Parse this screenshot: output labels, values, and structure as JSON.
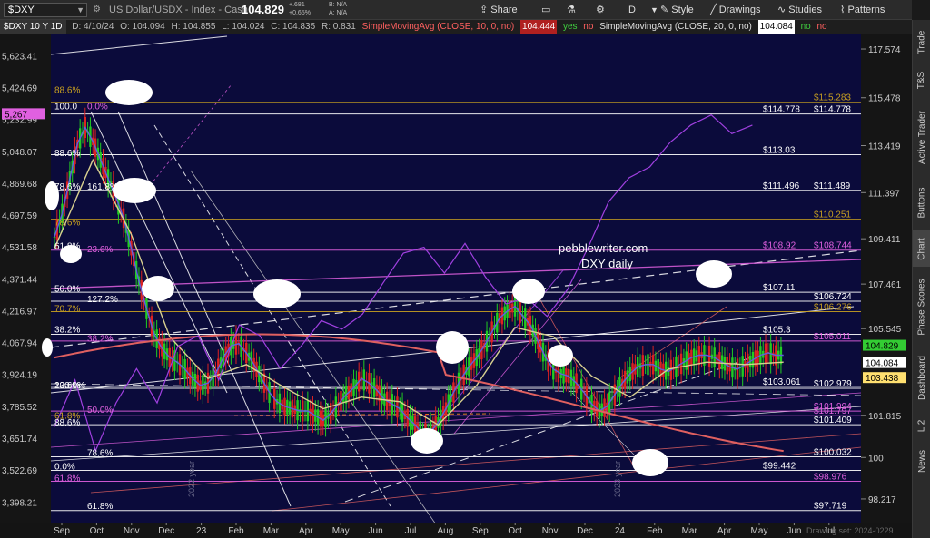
{
  "toolbar": {
    "symbol": "$DXY",
    "description": "US Dollar/USDX - Index - Cash",
    "last": "104.829",
    "change": "+.681",
    "change_pct": "+0.65%",
    "bid": "B: N/A",
    "ask": "A: N/A",
    "share_label": "Share",
    "aggregation": "D",
    "style_label": "Style",
    "drawings_label": "Drawings",
    "studies_label": "Studies",
    "patterns_label": "Patterns"
  },
  "status": {
    "period": "$DXY 10 Y 1D",
    "date": "D: 4/10/24",
    "open": "O: 104.094",
    "high": "H: 104.855",
    "low": "L: 104.024",
    "close": "C: 104.835",
    "range": "R: 0.831",
    "sma10": "SimpleMovingAvg (CLOSE, 10, 0, no)",
    "sma10_val": "104.444",
    "sma20": "SimpleMovingAvg (CLOSE, 20, 0, no)",
    "sma20_val": "104.084",
    "yes": "yes",
    "no": "no"
  },
  "side_tabs": [
    "Trade",
    "T&S",
    "Active Trader",
    "Buttons",
    "Chart",
    "Phase Scores",
    "Dashboard",
    "L 2",
    "News"
  ],
  "annotation": {
    "line1": "pebblewriter.com",
    "line2": "DXY daily"
  },
  "year_marks": [
    "2022 year",
    "2023 year"
  ],
  "drawing_status": "Drawing set: 2024-0229",
  "colors": {
    "background": "#0b0b3b",
    "price": "#a020d0",
    "spx": "#a040e0",
    "sma200": "#e06060",
    "sma_blue": "#6060e0",
    "sma_yellow": "#d8d090",
    "fib_gold": "#c8a020",
    "fib_magenta": "#e060e0",
    "white_line": "#ffffff"
  },
  "chart_data": {
    "type": "line",
    "ylim": [
      97.2,
      118.2
    ],
    "left_ylim": [
      3320,
      5760
    ],
    "x_ticks": [
      "Sep",
      "Oct",
      "Nov",
      "Dec",
      "23",
      "Feb",
      "Mar",
      "Apr",
      "May",
      "Jun",
      "Jul",
      "Aug",
      "Sep",
      "Oct",
      "Nov",
      "Dec",
      "24",
      "Feb",
      "Mar",
      "Apr",
      "May",
      "Jun",
      "Jul"
    ],
    "right_ticks": [
      117.574,
      115.478,
      113.419,
      111.397,
      109.411,
      107.461,
      105.545,
      101.815,
      100,
      98.217
    ],
    "left_ticks": [
      "5,623.41",
      "5,424.69",
      "5,232.99",
      "5,048.07",
      "4,869.68",
      "4,697.59",
      "4,531.58",
      "4,371.44",
      "4,216.97",
      "4,067.94",
      "3,924.19",
      "3,785.52",
      "3,651.74",
      "3,522.69",
      "3,398.21"
    ],
    "left_highlight": {
      "label": "5,267",
      "value": 5267
    },
    "right_labels": [
      {
        "label": "104.829",
        "value": 104.829,
        "color": "#33cc33"
      },
      {
        "label": "104.084",
        "value": 104.084,
        "color": "#ffffff"
      },
      {
        "label": "103.438",
        "value": 103.438,
        "color": "#ffe070"
      }
    ],
    "levels": [
      {
        "value": 115.283,
        "labels": [
          {
            "text": "115.283",
            "pos": "far"
          }
        ],
        "color": "#c8a020"
      },
      {
        "value": 114.778,
        "labels": [
          {
            "text": "114.778",
            "pos": "mid"
          },
          {
            "text": "114.778",
            "pos": "far"
          }
        ],
        "color": "#ffffff"
      },
      {
        "value": 113.03,
        "labels": [
          {
            "text": "113.03",
            "pos": "mid"
          }
        ],
        "color": "#ffffff"
      },
      {
        "value": 111.496,
        "labels": [
          {
            "text": "111.496",
            "pos": "mid"
          },
          {
            "text": "111.489",
            "pos": "far"
          }
        ],
        "color": "#ffffff"
      },
      {
        "value": 110.251,
        "labels": [
          {
            "text": "110.251",
            "pos": "far"
          }
        ],
        "color": "#c8a020"
      },
      {
        "value": 108.92,
        "labels": [
          {
            "text": "108.92",
            "pos": "mid"
          },
          {
            "text": "108.744",
            "pos": "far"
          }
        ],
        "color": "#e060e0"
      },
      {
        "value": 107.11,
        "labels": [
          {
            "text": "107.11",
            "pos": "mid"
          }
        ],
        "color": "#ffffff"
      },
      {
        "value": 106.724,
        "labels": [
          {
            "text": "106.724",
            "pos": "far"
          }
        ],
        "color": "#ffffff"
      },
      {
        "value": 106.276,
        "labels": [
          {
            "text": "106.276",
            "pos": "far"
          }
        ],
        "color": "#c8a020"
      },
      {
        "value": 105.3,
        "labels": [
          {
            "text": "105.3",
            "pos": "mid"
          }
        ],
        "color": "#ffffff"
      },
      {
        "value": 105.011,
        "labels": [
          {
            "text": "105.011",
            "pos": "far"
          }
        ],
        "color": "#e060e0"
      },
      {
        "value": 103.061,
        "labels": [
          {
            "text": "103.061",
            "pos": "mid"
          }
        ],
        "color": "#ffffff"
      },
      {
        "value": 102.979,
        "labels": [
          {
            "text": "102.979",
            "pos": "far"
          }
        ],
        "color": "#ffffff"
      },
      {
        "value": 101.994,
        "labels": [
          {
            "text": "101.994",
            "pos": "far"
          }
        ],
        "color": "#e060e0"
      },
      {
        "value": 101.797,
        "labels": [
          {
            "text": "101.797",
            "pos": "far"
          }
        ],
        "color": "#e060e0"
      },
      {
        "value": 101.409,
        "labels": [
          {
            "text": "101.409",
            "pos": "far"
          }
        ],
        "color": "#ffffff"
      },
      {
        "value": 100.032,
        "labels": [
          {
            "text": "100.032",
            "pos": "far"
          }
        ],
        "color": "#ffffff"
      },
      {
        "value": 99.442,
        "labels": [
          {
            "text": "99.442",
            "pos": "mid"
          }
        ],
        "color": "#ffffff"
      },
      {
        "value": 98.976,
        "labels": [
          {
            "text": "98.976",
            "pos": "far"
          }
        ],
        "color": "#e060e0"
      },
      {
        "value": 97.719,
        "labels": [
          {
            "text": "97.719",
            "pos": "far"
          }
        ],
        "color": "#ffffff"
      }
    ],
    "fib_labels": [
      {
        "text": "88.6%",
        "value": 115.6,
        "color": "#c8a020"
      },
      {
        "text": "0.0%",
        "value": 114.9,
        "color": "#e060e0"
      },
      {
        "text": "100.0",
        "value": 114.9,
        "color": "#ffffff"
      },
      {
        "text": "88.6%",
        "value": 112.9,
        "color": "#ffffff"
      },
      {
        "text": "161.8%",
        "value": 111.45,
        "color": "#ffffff"
      },
      {
        "text": "78.6%",
        "value": 111.45,
        "color": "#ffffff"
      },
      {
        "text": "78.6%",
        "value": 109.9,
        "color": "#c8a020"
      },
      {
        "text": "23.6%",
        "value": 108.75,
        "color": "#e060e0"
      },
      {
        "text": "61.8%",
        "value": 108.9,
        "color": "#ffffff"
      },
      {
        "text": "50.0%",
        "value": 107.05,
        "color": "#ffffff"
      },
      {
        "text": "127.2%",
        "value": 106.6,
        "color": "#ffffff"
      },
      {
        "text": "70.7%",
        "value": 106.2,
        "color": "#c8a020"
      },
      {
        "text": "38.2%",
        "value": 105.3,
        "color": "#ffffff"
      },
      {
        "text": "38.2%",
        "value": 104.9,
        "color": "#e060e0"
      },
      {
        "text": "100.0%",
        "value": 102.9,
        "color": "#ffffff"
      },
      {
        "text": "23.6%",
        "value": 102.9,
        "color": "#ffffff"
      },
      {
        "text": "50.0%",
        "value": 101.85,
        "color": "#e060e0"
      },
      {
        "text": "61.8%",
        "value": 101.6,
        "color": "#c8a020"
      },
      {
        "text": "88.6%",
        "value": 101.3,
        "color": "#ffffff"
      },
      {
        "text": "78.6%",
        "value": 100.0,
        "color": "#ffffff"
      },
      {
        "text": "0.0%",
        "value": 99.4,
        "color": "#ffffff"
      },
      {
        "text": "61.8%",
        "value": 98.9,
        "color": "#e060e0"
      },
      {
        "text": "61.8%",
        "value": 97.7,
        "color": "#ffffff"
      }
    ],
    "series": [
      {
        "name": "SimpleMovingAvg (CLOSE, 10, 0, no)",
        "x": [
          0,
          1,
          2,
          3,
          4,
          5,
          6,
          7,
          8,
          9,
          10,
          11,
          12,
          13,
          14,
          15,
          16,
          17,
          18,
          19,
          20,
          21,
          22,
          23,
          24,
          25,
          26,
          27,
          28,
          29,
          30,
          31,
          32,
          33,
          34,
          35,
          36,
          37,
          38,
          39,
          40,
          41,
          42,
          43,
          44,
          45,
          46,
          47,
          48,
          49,
          50,
          51,
          52,
          53,
          54,
          55,
          56,
          57,
          58,
          59,
          60,
          61,
          62,
          63,
          64,
          65,
          66,
          67,
          68,
          69,
          70,
          71,
          72,
          73,
          74,
          75,
          76,
          77,
          78,
          79,
          80,
          81,
          82,
          83,
          84,
          85,
          86,
          87,
          88,
          89,
          90,
          91,
          92,
          93,
          94,
          95
        ],
        "y": [
          109.5,
          110.5,
          112,
          113.5,
          114.2,
          113.6,
          112.8,
          112,
          111.2,
          110.3,
          109,
          107.6,
          106.4,
          105.3,
          104.7,
          104.3,
          104.1,
          103.8,
          103.4,
          103.1,
          103.2,
          103.6,
          104.3,
          104.8,
          104.9,
          104.5,
          104.0,
          103.4,
          102.8,
          102.4,
          102.2,
          102.1,
          102.0,
          102.0,
          101.8,
          101.6,
          101.9,
          102.3,
          102.7,
          103.0,
          103.4,
          103.2,
          102.9,
          102.5,
          102.3,
          102.1,
          101.7,
          101.4,
          101.0,
          101.1,
          101.5,
          102.1,
          102.8,
          103.4,
          103.9,
          104.3,
          104.8,
          105.4,
          106.0,
          106.3,
          106.5,
          106.1,
          105.7,
          105.0,
          104.3,
          103.8,
          103.6,
          103.5,
          103.2,
          102.8,
          102.3,
          102.0,
          102.2,
          102.7,
          103.2,
          103.6,
          103.9,
          104.0,
          104.0,
          103.8,
          103.7,
          103.9,
          104.1,
          104.3,
          104.4,
          104.4,
          104.3,
          104.1,
          103.9,
          103.8,
          104.0,
          104.2,
          104.4,
          104.5,
          104.4,
          104.4
        ]
      },
      {
        "name": "SimpleMovingAvg (CLOSE, 20, 0, no)",
        "x": [
          0,
          5,
          10,
          15,
          20,
          25,
          30,
          35,
          40,
          45,
          50,
          55,
          60,
          65,
          70,
          75,
          80,
          85,
          90,
          95
        ],
        "y": [
          109.0,
          112.8,
          109.6,
          105.2,
          103.4,
          104.0,
          103.0,
          102.1,
          102.6,
          102.4,
          101.4,
          103.1,
          105.6,
          105.2,
          103.5,
          102.6,
          103.8,
          104.1,
          104.0,
          104.1
        ]
      }
    ]
  }
}
